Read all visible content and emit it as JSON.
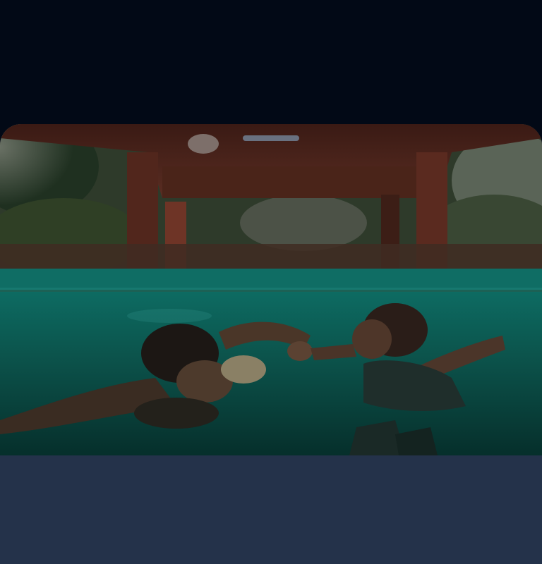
{
  "screen": {
    "background_color": "#020916",
    "sheet_color": "#24324a"
  },
  "sheet": {
    "drag_handle_color": "#697180",
    "image": {
      "subject": "two-swimmers-underwater-holding-hands",
      "alt": ""
    }
  }
}
